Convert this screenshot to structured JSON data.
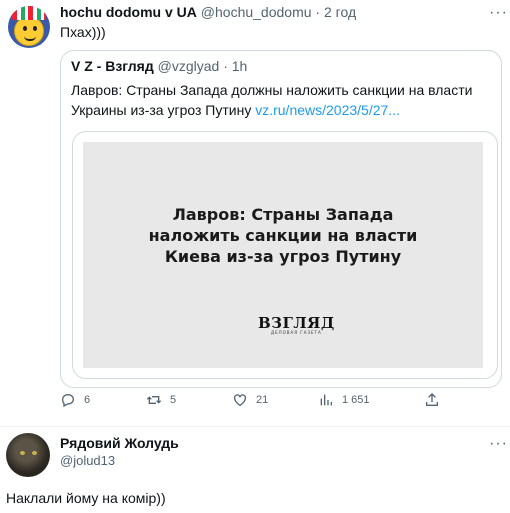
{
  "tweet": {
    "author_name": "hochu dodomu v UA",
    "author_handle": "@hochu_dodomu",
    "separator": " · ",
    "time": "2 год",
    "text": "Пхах)))",
    "more_icon": "more-dots-icon"
  },
  "quoted": {
    "author_name": "V Z - Взгляд",
    "author_handle": "@vzglyad",
    "separator": " · ",
    "time": "1h",
    "text": "Лавров: Страны Запада должны наложить санкции на власти Украины из-за угроз Путину ",
    "link": "vz.ru/news/2023/5/27...",
    "card": {
      "headline": "Лавров: Страны Запада\nналожить санкции на власти\nКиева из-за угроз Путину",
      "logo": "ВЗГЛЯД",
      "logo_sub": "ДЕЛОВАЯ ГАЗЕТА"
    }
  },
  "actions": {
    "reply_count": "6",
    "retweet_count": "5",
    "like_count": "21",
    "views_count": "1 651",
    "icons": [
      "reply-icon",
      "retweet-icon",
      "like-icon",
      "views-icon",
      "share-icon"
    ]
  },
  "reply": {
    "author_name": "Рядовий Жолудь",
    "author_handle": "@jolud13",
    "text": "Наклали йому на комір))",
    "more_icon": "more-dots-icon"
  },
  "colors": {
    "link": "#1d9bf0",
    "muted": "#536471",
    "border": "#cfd9de"
  }
}
